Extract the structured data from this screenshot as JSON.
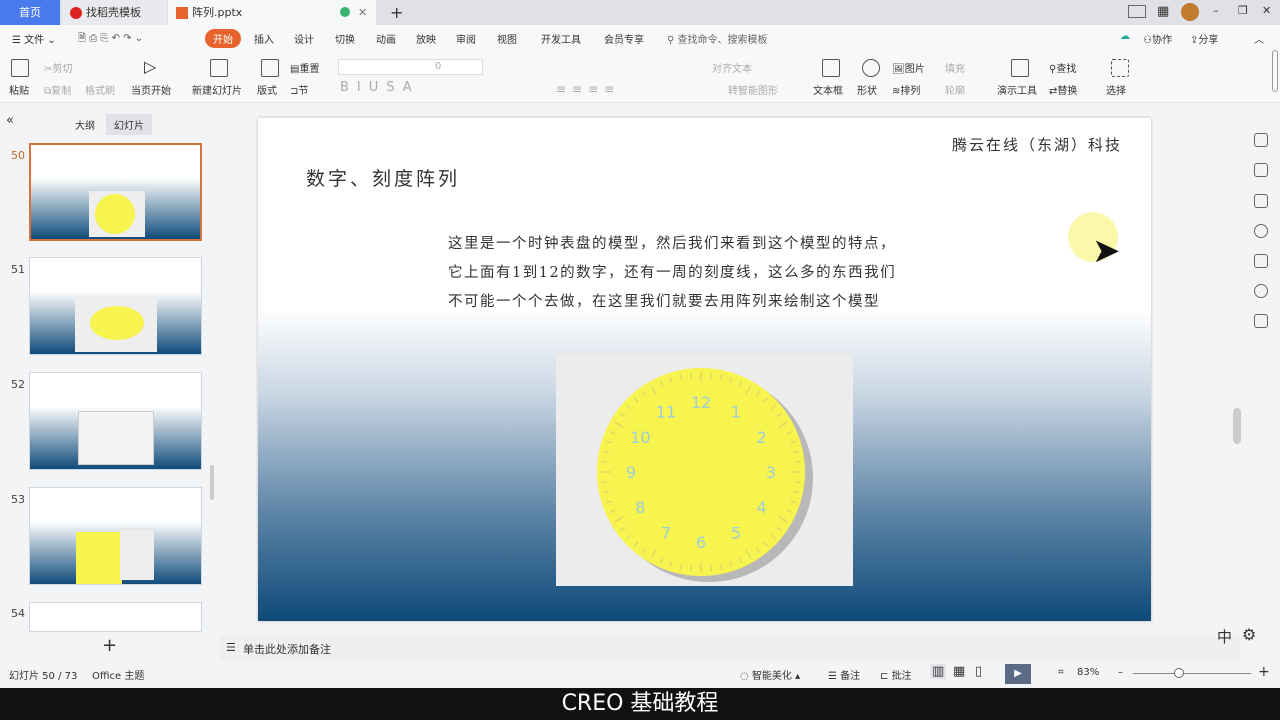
{
  "tabs": [
    {
      "label": "首页"
    },
    {
      "label": "找稻壳模板"
    },
    {
      "label": "阵列.pptx"
    }
  ],
  "menu": {
    "file": "文件",
    "items": [
      "开始",
      "插入",
      "设计",
      "切换",
      "动画",
      "放映",
      "审阅",
      "视图",
      "开发工具",
      "会员专享"
    ],
    "search_placeholder": "查找命令、搜索模板",
    "collab": "协作",
    "share": "分享"
  },
  "toolbar": {
    "paste": "粘贴",
    "cut": "剪切",
    "copy": "复制",
    "format_painter": "格式刷",
    "from_current": "当页开始",
    "new_slide": "新建幻灯片",
    "layout": "版式",
    "section": "节",
    "reset": "重置",
    "font_size": "0",
    "align_text": "对齐文本",
    "smartart": "转智能图形",
    "textbox": "文本框",
    "shape": "形状",
    "picture": "图片",
    "arrange": "排列",
    "fill": "填充",
    "outline": "轮廓",
    "presenter_tools": "演示工具",
    "find": "查找",
    "replace": "替换",
    "select": "选择"
  },
  "left_panel": {
    "tab_outline": "大纲",
    "tab_slides": "幻灯片",
    "slides": [
      "50",
      "51",
      "52",
      "53",
      "54"
    ],
    "add": "+"
  },
  "slide": {
    "company": "腾云在线（东湖）科技",
    "title": "数字、刻度阵列",
    "body": [
      "这里是一个时钟表盘的模型，然后我们来看到这个模型的特点，",
      "它上面有1到12的数字，还有一周的刻度线，这么多的东西我们",
      "不可能一个个去做，在这里我们就要去用阵列来绘制这个模型"
    ],
    "clock_numbers": [
      "12",
      "1",
      "2",
      "3",
      "4",
      "5",
      "6",
      "7",
      "8",
      "9",
      "10",
      "11"
    ]
  },
  "notes": {
    "placeholder": "单击此处添加备注"
  },
  "status": {
    "slide_count": "幻灯片 50 / 73",
    "theme": "Office 主题",
    "beautify": "智能美化",
    "notes": "备注",
    "comment": "批注",
    "zoom": "83%",
    "ime": "中"
  },
  "caption": "CREO 基础教程",
  "colors": {
    "accent": "#e8632b",
    "tab_home": "#4a7bec",
    "clock": "#f7f34f"
  }
}
